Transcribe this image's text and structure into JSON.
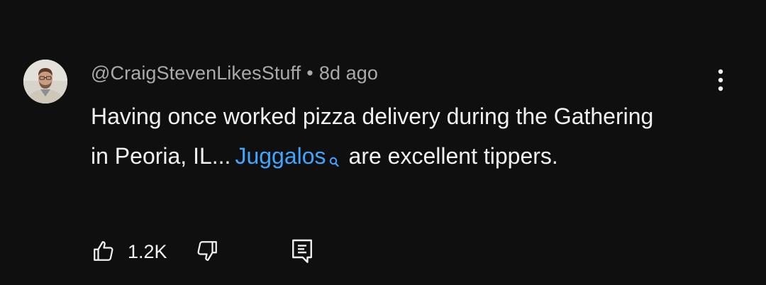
{
  "comment": {
    "author": "@CraigStevenLikesStuff",
    "separator": "•",
    "timestamp": "8d ago",
    "text_before": "Having once worked pizza delivery during the Gathering in Peoria, IL...",
    "tag": "Juggalos",
    "text_after": "are excellent tippers.",
    "like_count": "1.2K"
  },
  "icons": {
    "avatar": "avatar",
    "search": "search-icon",
    "menu": "more-vert-icon",
    "like": "thumbs-up-icon",
    "dislike": "thumbs-down-icon",
    "reply": "reply-icon"
  },
  "colors": {
    "background": "#0f0f0f",
    "text_primary": "#f1f1f1",
    "text_secondary": "#aaaaaa",
    "link": "#3ea6ff"
  }
}
